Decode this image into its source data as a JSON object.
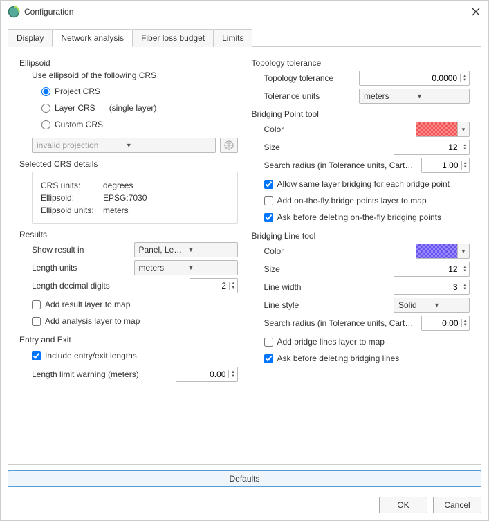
{
  "window": {
    "title": "Configuration"
  },
  "tabs": {
    "display": "Display",
    "network": "Network analysis",
    "fiber": "Fiber loss budget",
    "limits": "Limits"
  },
  "ellipsoid": {
    "title": "Ellipsoid",
    "use_label": "Use ellipsoid of the following CRS",
    "project": "Project CRS",
    "layer": "Layer CRS",
    "layer_hint": "(single layer)",
    "custom": "Custom CRS",
    "projection": "invalid projection"
  },
  "crs_details": {
    "title": "Selected CRS details",
    "units_label": "CRS units:",
    "units_value": "degrees",
    "ellipsoid_label": "Ellipsoid:",
    "ellipsoid_value": "EPSG:7030",
    "ell_units_label": "Ellipsoid units:",
    "ell_units_value": "meters"
  },
  "results": {
    "title": "Results",
    "show_label": "Show result in",
    "show_value": "Panel, Length and loss",
    "length_units_label": "Length units",
    "length_units_value": "meters",
    "decimal_label": "Length decimal digits",
    "decimal_value": "2",
    "add_result": "Add result layer to map",
    "add_analysis": "Add analysis layer to map"
  },
  "entry": {
    "title": "Entry and Exit",
    "include": "Include entry/exit lengths",
    "limit_label": "Length limit warning (meters)",
    "limit_value": "0.00"
  },
  "topology": {
    "title": "Topology tolerance",
    "tol_label": "Topology tolerance",
    "tol_value": "0.0000",
    "units_label": "Tolerance units",
    "units_value": "meters"
  },
  "bridge_point": {
    "title": "Bridging Point tool",
    "color_label": "Color",
    "size_label": "Size",
    "size_value": "12",
    "radius_label": "Search radius (in Tolerance units, Cartesian calculation)",
    "radius_value": "1.00",
    "allow_same": "Allow same layer bridging for each bridge point",
    "add_fly": "Add on-the-fly bridge points layer to map",
    "ask_delete": "Ask before deleting on-the-fly bridging points"
  },
  "bridge_line": {
    "title": "Bridging Line tool",
    "color_label": "Color",
    "size_label": "Size",
    "size_value": "12",
    "width_label": "Line width",
    "width_value": "3",
    "style_label": "Line style",
    "style_value": "Solid",
    "radius_label": "Search radius (in Tolerance units, Cartesian calculation)",
    "radius_value": "0.00",
    "add_layer": "Add bridge lines layer to map",
    "ask_delete": "Ask before deleting bridging lines"
  },
  "buttons": {
    "defaults": "Defaults",
    "ok": "OK",
    "cancel": "Cancel"
  }
}
